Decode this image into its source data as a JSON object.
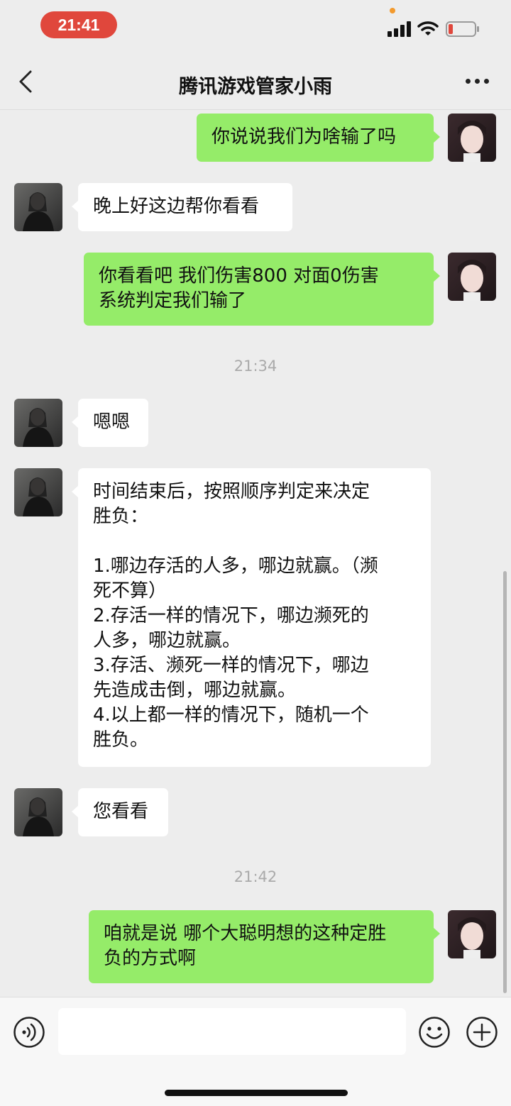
{
  "status_bar": {
    "time": "21:41",
    "battery_level": 0.15,
    "recording_dot_color": "#f39a2d"
  },
  "header": {
    "title": "腾讯游戏管家小雨",
    "back_icon": "chevron-left-icon",
    "more_icon": "more-dots-icon"
  },
  "messages": [
    {
      "side": "out",
      "text": "你说说我们为啥输了吗"
    },
    {
      "side": "in",
      "text": "晚上好这边帮你看看"
    },
    {
      "side": "out",
      "text": "你看看吧 我们伤害800 对面0伤害\n系统判定我们输了"
    },
    {
      "type": "time",
      "text": "21:34"
    },
    {
      "side": "in",
      "text": "嗯嗯"
    },
    {
      "side": "in",
      "text": "时间结束后，按照顺序判定来决定\n胜负：\n\n1.哪边存活的人多，哪边就赢。（濒\n死不算）\n2.存活一样的情况下，哪边濒死的\n人多，哪边就赢。\n3.存活、濒死一样的情况下，哪边\n先造成击倒，哪边就赢。\n4.以上都一样的情况下，随机一个\n胜负。"
    },
    {
      "side": "in",
      "text": "您看看"
    },
    {
      "type": "time",
      "text": "21:42"
    },
    {
      "side": "out",
      "text": "咱就是说 哪个大聪明想的这种定胜\n负的方式啊"
    }
  ],
  "input_bar": {
    "placeholder": "",
    "voice_icon": "voice-icon",
    "emoji_icon": "emoji-icon",
    "plus_icon": "plus-icon"
  },
  "colors": {
    "background": "#ededed",
    "outgoing_bubble": "#95ec69",
    "incoming_bubble": "#ffffff",
    "time_pill": "#e0473c"
  }
}
